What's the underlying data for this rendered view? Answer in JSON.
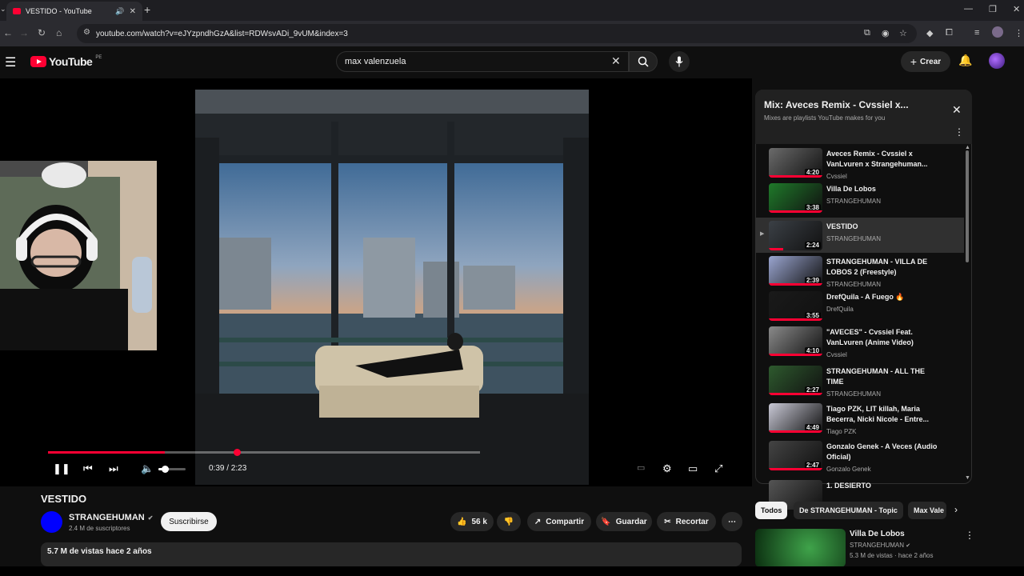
{
  "browser": {
    "tab_title": "VESTIDO - YouTube",
    "url": "youtube.com/watch?v=eJYzpndhGzA&list=RDWsvADi_9vUM&index=3"
  },
  "header": {
    "logo_text": "YouTube",
    "country_code": "PE",
    "search_value": "max valenzuela",
    "create_label": "Crear"
  },
  "player": {
    "time_current": "0:39",
    "time_total": "2:23",
    "time_display": "0:39 / 2:23",
    "progress": 0.27,
    "volume": 0.2
  },
  "video": {
    "title": "VESTIDO",
    "channel": "STRANGEHUMAN",
    "subscribers": "2.4 M de suscriptores",
    "subscribe_label": "Suscribirse",
    "likes": "56 k",
    "share_label": "Compartir",
    "save_label": "Guardar",
    "clip_label": "Recortar",
    "views_date": "5.7 M de vistas  hace 2 años"
  },
  "playlist": {
    "title": "Mix: Aveces Remix - Cvssiel x...",
    "subtitle": "Mixes are playlists YouTube makes for you",
    "items": [
      {
        "title": "Aveces Remix - Cvssiel x VanLvuren x Strangehuman...",
        "channel": "Cvssiel",
        "duration": "4:20",
        "active": false
      },
      {
        "title": "Villa De Lobos",
        "channel": "STRANGEHUMAN",
        "duration": "3:38",
        "active": false
      },
      {
        "title": "VESTIDO",
        "channel": "STRANGEHUMAN",
        "duration": "2:24",
        "active": true
      },
      {
        "title": "STRANGEHUMAN - VILLA DE LOBOS 2 (Freestyle)",
        "channel": "STRANGEHUMAN",
        "duration": "2:39",
        "active": false
      },
      {
        "title": "DrefQuila - A Fuego 🔥",
        "channel": "DrefQuila",
        "duration": "3:55",
        "active": false
      },
      {
        "title": "\"AVECES\" - Cvssiel Feat. VanLvuren (Anime Video)",
        "channel": "Cvssiel",
        "duration": "4:10",
        "active": false
      },
      {
        "title": "STRANGEHUMAN - ALL THE TIME",
        "channel": "STRANGEHUMAN",
        "duration": "2:27",
        "active": false
      },
      {
        "title": "Tiago PZK, LIT killah, Maria Becerra, Nicki Nicole - Entre...",
        "channel": "Tiago PZK",
        "duration": "4:49",
        "active": false
      },
      {
        "title": "Gonzalo Genek - A Veces (Audio Oficial)",
        "channel": "Gonzalo Genek",
        "duration": "2:47",
        "active": false
      },
      {
        "title": "1. DESIERTO",
        "channel": "",
        "duration": "",
        "active": false
      }
    ]
  },
  "chips": [
    "Todos",
    "De STRANGEHUMAN - Topic",
    "Max Vale"
  ],
  "recommended": {
    "title": "Villa De Lobos",
    "channel": "STRANGEHUMAN",
    "views": "5.3 M de vistas · hace 2 años"
  },
  "colors": {
    "accent": "#ff0033",
    "background": "#0f0f0f"
  }
}
